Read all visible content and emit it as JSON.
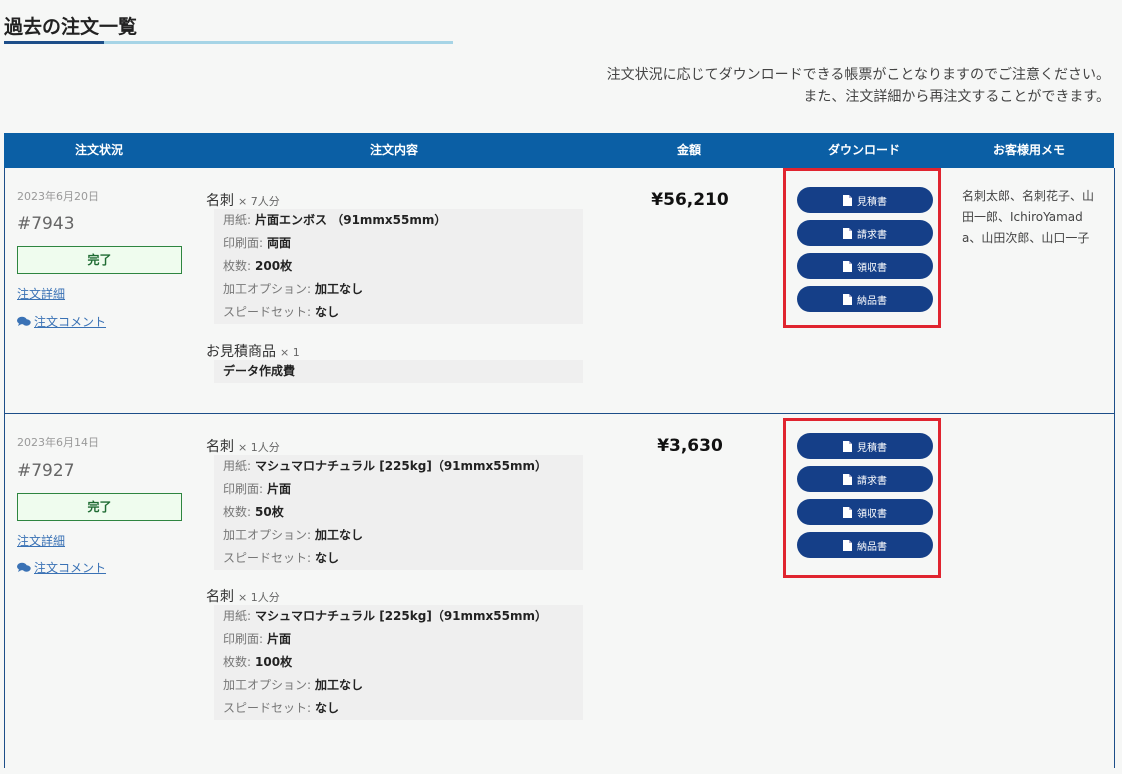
{
  "page": {
    "title": "過去の注文一覧",
    "notice_line1": "注文状況に応じてダウンロードできる帳票がことなりますのでご注意ください。",
    "notice_line2": "また、注文詳細から再注文することができます。"
  },
  "columns": {
    "status": "注文状況",
    "content": "注文内容",
    "amount": "金額",
    "download": "ダウンロード",
    "memo": "お客様用メモ"
  },
  "download_labels": {
    "estimate": "見積書",
    "invoice": "請求書",
    "receipt": "領収書",
    "delivery": "納品書"
  },
  "colors": {
    "header_bg": "#0b5fa5",
    "button_bg": "#153f88",
    "highlight_frame": "#e0242f",
    "status_border": "#2e8540"
  },
  "orders": [
    {
      "date": "2023年6月20日",
      "number": "#7943",
      "status": "完了",
      "detail_link": "注文詳細",
      "comment_link": "注文コメント",
      "amount": "¥56,210",
      "memo": "名刺太郎、名刺花子、山田一郎、IchiroYamada、山田次郎、山口一子",
      "items": [
        {
          "name": "名刺",
          "qty": "× 7人分",
          "specs": [
            {
              "label": "用紙:",
              "value": "片面エンボス （91mmx55mm）"
            },
            {
              "label": "印刷面:",
              "value": "両面"
            },
            {
              "label": "枚数:",
              "value": "200枚"
            },
            {
              "label": "加工オプション:",
              "value": "加工なし"
            },
            {
              "label": "スピードセット:",
              "value": "なし"
            }
          ]
        }
      ],
      "estimate_item": {
        "name": "お見積商品",
        "qty": "× 1",
        "detail": "データ作成費"
      }
    },
    {
      "date": "2023年6月14日",
      "number": "#7927",
      "status": "完了",
      "detail_link": "注文詳細",
      "comment_link": "注文コメント",
      "amount": "¥3,630",
      "items": [
        {
          "name": "名刺",
          "qty": "× 1人分",
          "specs": [
            {
              "label": "用紙:",
              "value": "マシュマロナチュラル [225kg]（91mmx55mm）"
            },
            {
              "label": "印刷面:",
              "value": "片面"
            },
            {
              "label": "枚数:",
              "value": "50枚"
            },
            {
              "label": "加工オプション:",
              "value": "加工なし"
            },
            {
              "label": "スピードセット:",
              "value": "なし"
            }
          ]
        },
        {
          "name": "名刺",
          "qty": "× 1人分",
          "specs": [
            {
              "label": "用紙:",
              "value": "マシュマロナチュラル [225kg]（91mmx55mm）"
            },
            {
              "label": "印刷面:",
              "value": "片面"
            },
            {
              "label": "枚数:",
              "value": "100枚"
            },
            {
              "label": "加工オプション:",
              "value": "加工なし"
            },
            {
              "label": "スピードセット:",
              "value": "なし"
            }
          ]
        }
      ]
    }
  ]
}
